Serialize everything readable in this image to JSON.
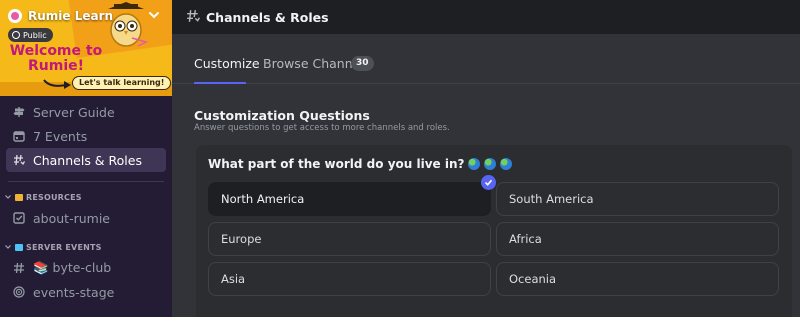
{
  "sidebar": {
    "server_name": "Rumie Learn",
    "public_label": "Public",
    "banner_headline": "Welcome to Rumie!",
    "banner_tagline": "Let's talk learning!",
    "nav_top": [
      {
        "label": "Server Guide",
        "icon": "signpost-icon"
      },
      {
        "label": "7 Events",
        "icon": "calendar-icon"
      },
      {
        "label": "Channels & Roles",
        "icon": "channels-roles-icon",
        "active": true
      }
    ],
    "categories": [
      {
        "name": "RESOURCES",
        "emoji_color": "#f0b232",
        "channels": [
          {
            "label": "about-rumie",
            "icon": "rules-check-icon"
          }
        ]
      },
      {
        "name": "SERVER EVENTS",
        "emoji_color": "#4fc3f7",
        "channels": [
          {
            "label": "📚 byte-club",
            "icon": "hash-icon"
          },
          {
            "label": "events-stage",
            "icon": "stage-icon"
          }
        ]
      }
    ]
  },
  "header": {
    "title": "Channels & Roles"
  },
  "tabs": [
    {
      "label": "Customize",
      "active": true
    },
    {
      "label": "Browse Channels",
      "badge": "30"
    }
  ],
  "section": {
    "title": "Customization Questions",
    "subtitle": "Answer questions to get access to more channels and roles."
  },
  "question": {
    "text": "What part of the world do you live in?",
    "emoji": "globe-icons",
    "options": [
      {
        "label": "North America",
        "selected": true
      },
      {
        "label": "South America",
        "selected": false
      },
      {
        "label": "Europe",
        "selected": false
      },
      {
        "label": "Africa",
        "selected": false
      },
      {
        "label": "Asia",
        "selected": false
      },
      {
        "label": "Oceania",
        "selected": false
      }
    ]
  },
  "colors": {
    "accent": "#5865f2",
    "sidebar_bg": "#241c35",
    "active_item": "#3f3655",
    "banner": "#f5b91a"
  }
}
